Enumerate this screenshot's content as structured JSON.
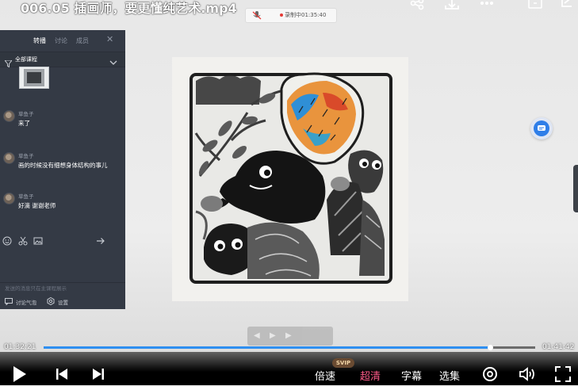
{
  "player": {
    "title": "006.05 插画师，要更懂纯艺术.mp4",
    "current_time": "01:32:21",
    "duration": "01:41:42",
    "progress": 0.908,
    "controls": {
      "speed_label": "倍速",
      "quality_label": "超清",
      "quality_badge": "SVIP",
      "subtitle_label": "字幕",
      "episodes_label": "选集"
    },
    "accent_color": "#2f8ff0",
    "quality_color": "#ff5b8a"
  },
  "recording": {
    "label": "录制中01:35:40"
  },
  "chat": {
    "tabs": [
      {
        "label": "转播",
        "active": true
      },
      {
        "label": "讨论",
        "active": false
      },
      {
        "label": "成员",
        "active": false
      }
    ],
    "filter_label": "全部课程",
    "messages": [
      {
        "author": "草鱼子",
        "text": "来了"
      },
      {
        "author": "草鱼子",
        "text": "画的时候没有细想身体结构的事儿"
      },
      {
        "author": "草鱼子",
        "text": "好滴 谢谢老师"
      }
    ],
    "hint": "发送的消息只在主课程展示",
    "footer": {
      "bubble_label": "讨论气泡",
      "settings_label": "设置"
    }
  },
  "icons": [
    "share-icon",
    "download-icon",
    "more-icon",
    "fullscreen-window-icon",
    "collapse-icon",
    "mic-muted-icon",
    "filter-icon",
    "chevron-down-icon",
    "close-icon",
    "emoji-icon",
    "scissors-icon",
    "image-icon",
    "send-icon",
    "bubble-icon",
    "settings-icon",
    "chat-bubble-icon",
    "play-icon",
    "prev-icon",
    "next-icon",
    "danmaku-icon",
    "volume-icon",
    "fullscreen-icon"
  ]
}
